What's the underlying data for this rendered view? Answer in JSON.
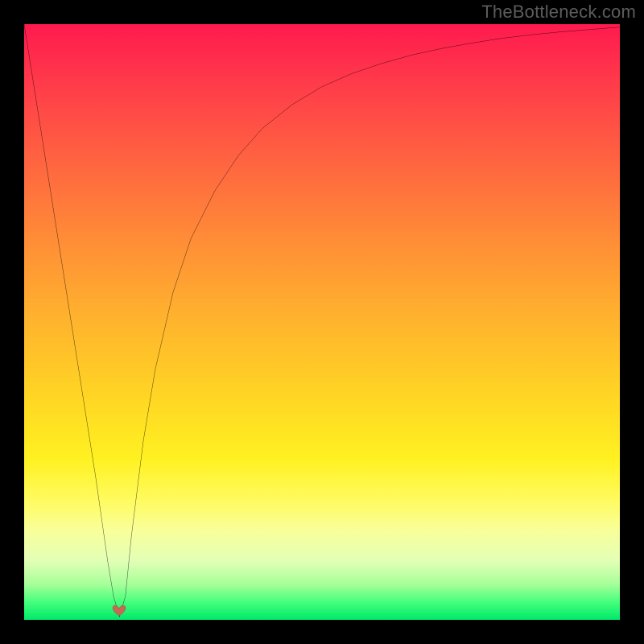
{
  "watermark": "TheBottleneck.com",
  "chart_data": {
    "type": "line",
    "title": "",
    "xlabel": "",
    "ylabel": "",
    "xlim": [
      0,
      100
    ],
    "ylim": [
      0,
      100
    ],
    "x": [
      0,
      3,
      6,
      9,
      12,
      14,
      15,
      16,
      17,
      18,
      20,
      22,
      25,
      28,
      32,
      36,
      40,
      45,
      50,
      55,
      60,
      65,
      70,
      75,
      80,
      85,
      90,
      95,
      100
    ],
    "values": [
      100,
      81,
      62,
      43,
      24,
      10,
      4,
      0.5,
      4,
      14,
      30,
      42,
      55,
      64,
      72,
      78,
      82.5,
      86.5,
      89.5,
      91.7,
      93.4,
      94.8,
      95.9,
      96.8,
      97.6,
      98.2,
      98.7,
      99.1,
      99.5
    ],
    "marker": {
      "x": 16,
      "y": 1.5,
      "shape": "heart",
      "color": "#c46a54"
    },
    "background_gradient": {
      "top": "#ff1a4e",
      "mid": "#ffd424",
      "bottom": "#00e86a"
    }
  }
}
